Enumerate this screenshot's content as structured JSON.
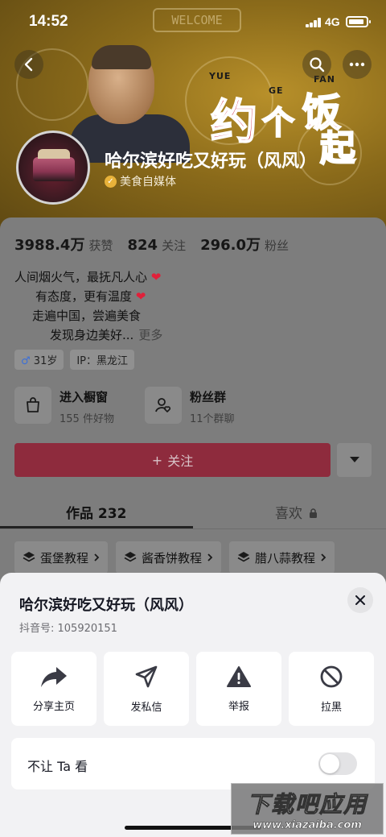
{
  "status_bar": {
    "time": "14:52",
    "network": "4G"
  },
  "banner": {
    "welcome_text": "WELCOME",
    "poster_big_1": "约",
    "poster_big_2": "个",
    "poster_big_3": "饭",
    "poster_big_4": "起",
    "poster_small_1": "YUE",
    "poster_small_2": "GE",
    "poster_small_3": "FAN"
  },
  "profile": {
    "name": "哈尔滨好吃又好玩（风风）",
    "verification": "美食自媒体",
    "stats": [
      {
        "value": "3988.4万",
        "label": "获赞"
      },
      {
        "value": "824",
        "label": "关注"
      },
      {
        "value": "296.0万",
        "label": "粉丝"
      }
    ],
    "bio": {
      "line1": "人间烟火气，最抚凡人心",
      "line2": "有态度，更有温度",
      "line3": "走遍中国，尝遍美食",
      "line4": "发现身边美好...",
      "more": "更多",
      "heart": "❤"
    },
    "tags": {
      "gender_symbol": "♂",
      "age": "31岁",
      "ip": "IP：黑龙江"
    },
    "entries": [
      {
        "title": "进入橱窗",
        "subtitle": "155 件好物",
        "icon": "shopping-bag-icon"
      },
      {
        "title": "粉丝群",
        "subtitle": "11个群聊",
        "icon": "fan-group-icon"
      }
    ],
    "follow_label": "关注",
    "follow_plus": "+",
    "tabs": {
      "works": "作品 232",
      "likes": "喜欢"
    },
    "collections": [
      "蛋堡教程",
      "酱香饼教程",
      "腊八蒜教程"
    ]
  },
  "sheet": {
    "title": "哈尔滨好吃又好玩（风风）",
    "douyin_id": "抖音号: 105920151",
    "actions": [
      {
        "label": "分享主页",
        "icon": "share-icon"
      },
      {
        "label": "发私信",
        "icon": "send-message-icon"
      },
      {
        "label": "举报",
        "icon": "report-icon"
      },
      {
        "label": "拉黑",
        "icon": "block-icon"
      }
    ],
    "hide_label": "不让 Ta 看",
    "hide_enabled": false
  },
  "watermark": {
    "line1": "下载吧应用",
    "line2": "www.xiazaiba.com"
  },
  "colors": {
    "follow_button": "#8e2b3d",
    "sheet_bg": "#f2f2f4",
    "heart": "#e0203a"
  }
}
